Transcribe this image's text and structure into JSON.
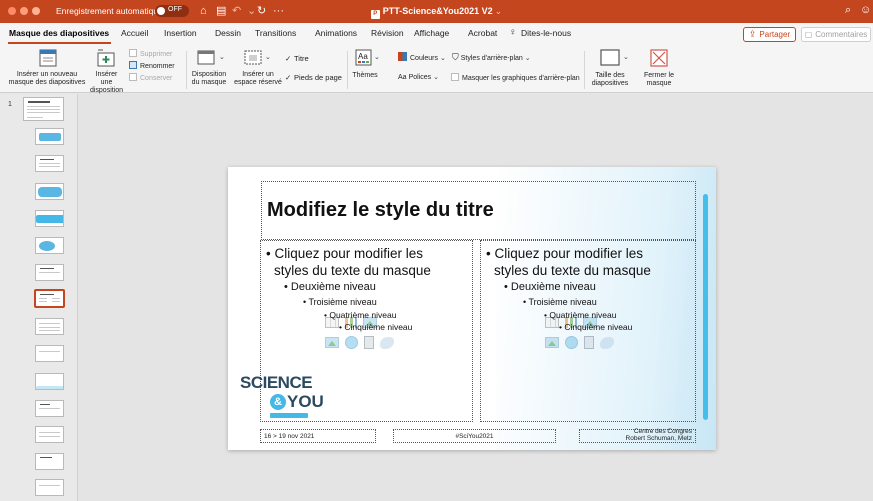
{
  "titlebar": {
    "autosave_label": "Enregistrement automatique",
    "toggle_state": "OFF",
    "doc_icon": "P",
    "document_title": "PTT-Science&You2021 V2",
    "document_caret": "⌄",
    "icons": [
      "home-icon",
      "save-icon",
      "undo-icon",
      "redo-icon",
      "more-icon",
      "search-icon",
      "smiley-icon"
    ]
  },
  "tabs": [
    "Masque des diapositives",
    "Accueil",
    "Insertion",
    "Dessin",
    "Transitions",
    "Animations",
    "Révision",
    "Affichage",
    "Acrobat",
    "Dites-le-nous"
  ],
  "share_label": "Partager",
  "comments_label": "Commentaires",
  "ribbon": {
    "insert_master": "Insérer un nouveau\nmasque des diapositives",
    "insert_layout": "Insérer une\ndisposition",
    "delete": "Supprimer",
    "rename": "Renommer",
    "preserve": "Conserver",
    "master_layout": "Disposition\ndu masque",
    "insert_placeholder": "Insérer un\nespace réservé",
    "title_check": "Titre",
    "footers_check": "Pieds de page",
    "themes": "Thèmes",
    "colors": "Couleurs",
    "background_styles": "Styles d'arrière-plan",
    "fonts": "Polices",
    "hide_background": "Masquer les graphiques d'arrière-plan",
    "slide_size": "Taille des\ndiapositives",
    "close_master": "Fermer le\nmasque"
  },
  "thumbnail_pane": {
    "slide_number": "1"
  },
  "slide": {
    "title": "Modifiez le style du titre",
    "body_levels": [
      "Cliquez pour modifier les styles du texte du masque",
      "Deuxième niveau",
      "Troisième niveau",
      "Quatrième niveau",
      "Cinquième niveau"
    ],
    "body_l1_line1": "Cliquez pour modifier les",
    "body_l1_line2": "styles du texte du masque",
    "logo_science": "SCIENCE",
    "logo_amp": "&",
    "logo_you": "YOU",
    "footer_date": "16 > 19 nov 2021",
    "footer_center": "#SciYou2021",
    "footer_place_line1": "Centre des Congres",
    "footer_place_line2": "Robert Schuman, Metz"
  },
  "colors": {
    "brand": "#c4461f",
    "accent_blue": "#45bfe9",
    "logo_navy": "#2b4a60"
  }
}
